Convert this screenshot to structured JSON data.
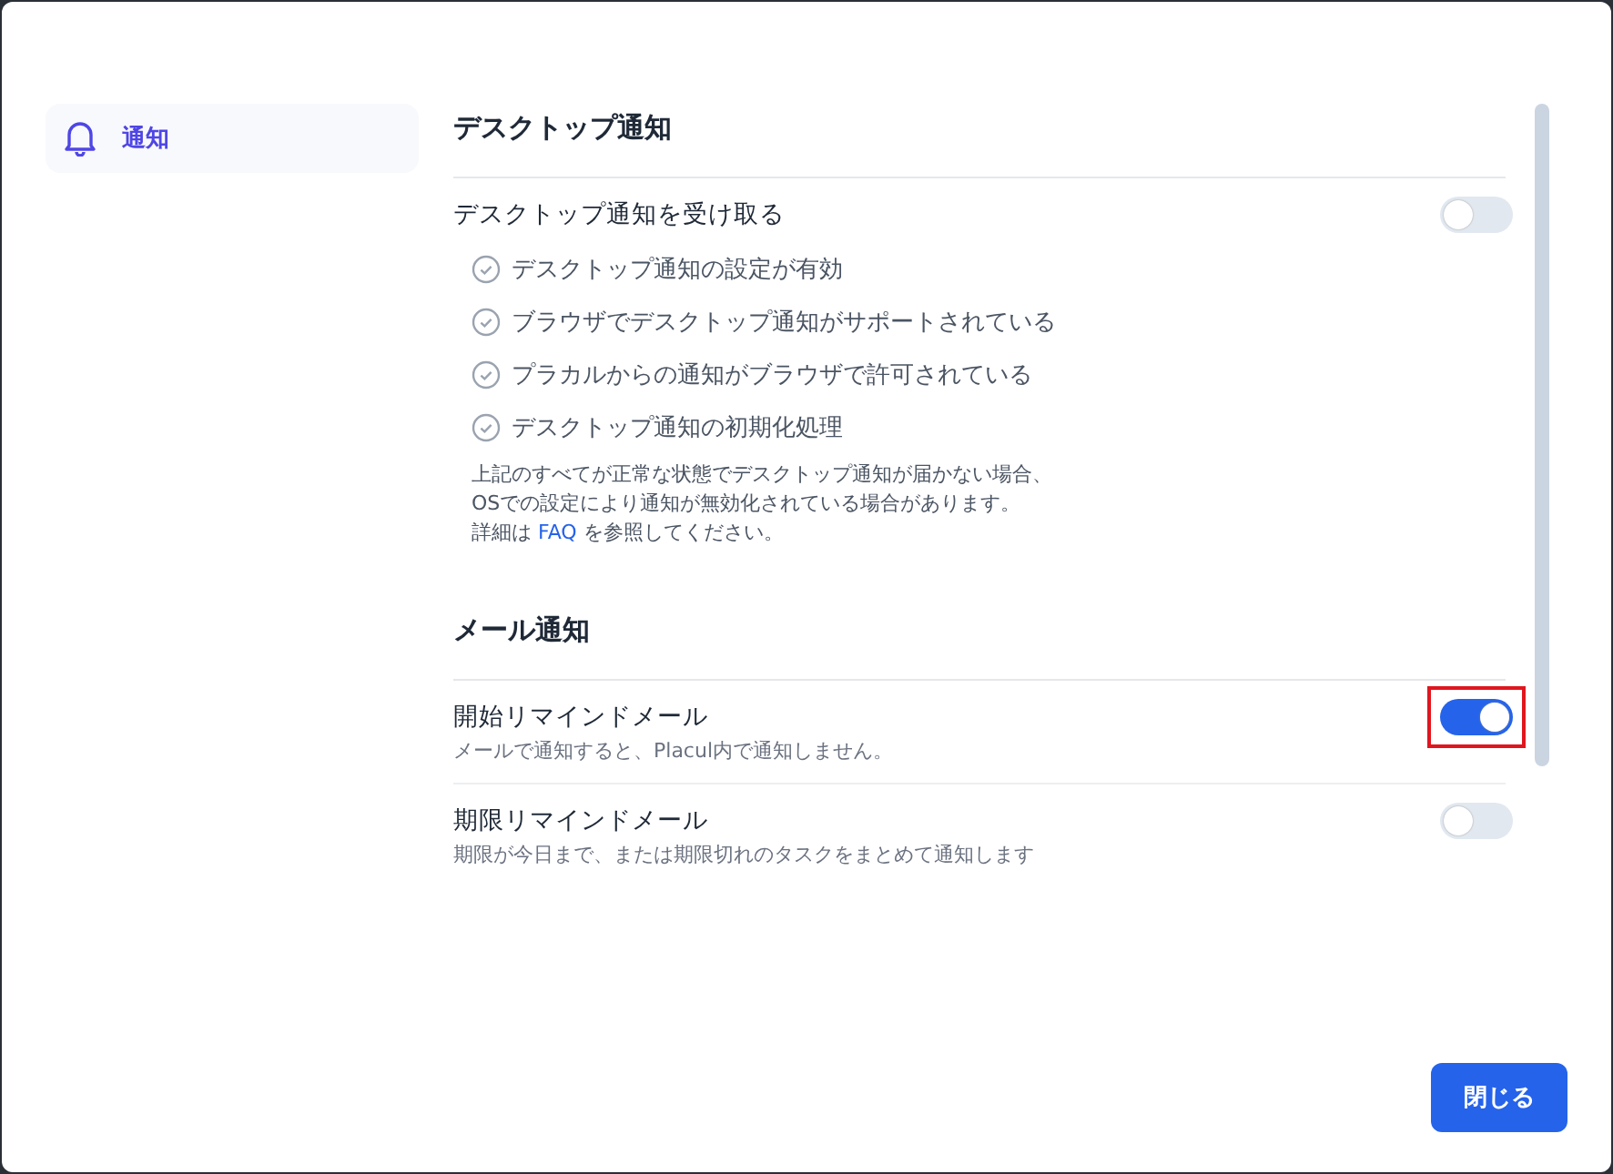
{
  "sidebar": {
    "items": [
      {
        "label": "通知",
        "selected": true
      }
    ]
  },
  "sections": [
    {
      "title": "デスクトップ通知",
      "settings": [
        {
          "label": "デスクトップ通知を受け取る",
          "on": false,
          "highlighted": false,
          "checks": [
            {
              "label": "デスクトップ通知の設定が有効",
              "checked": true
            },
            {
              "label": "ブラウザでデスクトップ通知がサポートされている",
              "checked": true
            },
            {
              "label": "プラカルからの通知がブラウザで許可されている",
              "checked": true
            },
            {
              "label": "デスクトップ通知の初期化処理",
              "checked": true
            }
          ],
          "note": {
            "lines": [
              "上記のすべてが正常な状態でデスクトップ通知が届かない場合、",
              "OSでの設定により通知が無効化されている場合があります。"
            ],
            "prefix": "詳細は",
            "link": "FAQ",
            "suffix": "を参照してください。"
          }
        }
      ]
    },
    {
      "title": "メール通知",
      "settings": [
        {
          "label": "開始リマインドメール",
          "description": "メールで通知すると、Placul内で通知しません。",
          "on": true,
          "highlighted": true
        },
        {
          "label": "期限リマインドメール",
          "description": "期限が今日まで、または期限切れのタスクをまとめて通知します",
          "on": false,
          "highlighted": false
        }
      ]
    }
  ],
  "close_button": "閉じる"
}
